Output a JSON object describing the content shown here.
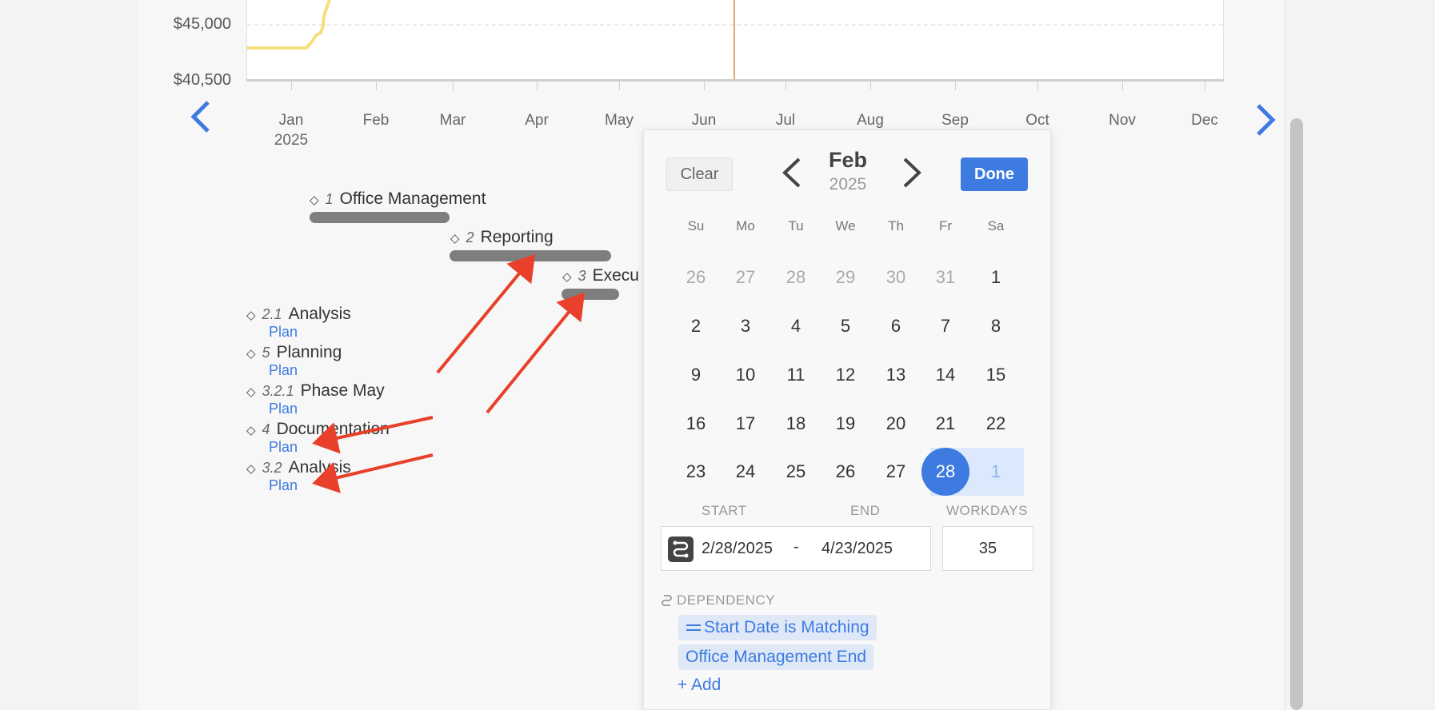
{
  "chart": {
    "y_labels": [
      "$45,000",
      "$40,500"
    ],
    "months": [
      "Jan",
      "Feb",
      "Mar",
      "Apr",
      "May",
      "Jun",
      "Jul",
      "Aug",
      "Sep",
      "Oct",
      "Nov",
      "Dec"
    ],
    "year_label": "2025",
    "series_color": "#f6de7a",
    "today_line_color": "#e3a86a"
  },
  "tasks": [
    {
      "num": "1",
      "name": "Office Management"
    },
    {
      "num": "2",
      "name": "Reporting"
    },
    {
      "num": "3",
      "name": "Execu"
    },
    {
      "num": "2.1",
      "name": "Analysis",
      "link": "Plan"
    },
    {
      "num": "5",
      "name": "Planning",
      "link": "Plan"
    },
    {
      "num": "3.2.1",
      "name": "Phase May",
      "link": "Plan"
    },
    {
      "num": "4",
      "name": "Documentation",
      "link": "Plan"
    },
    {
      "num": "3.2",
      "name": "Analysis",
      "link": "Plan"
    }
  ],
  "datepicker": {
    "clear_label": "Clear",
    "done_label": "Done",
    "month": "Feb",
    "year": "2025",
    "weekdays": [
      "Su",
      "Mo",
      "Tu",
      "We",
      "Th",
      "Fr",
      "Sa"
    ],
    "weeks": [
      [
        "26",
        "27",
        "28",
        "29",
        "30",
        "31",
        "1"
      ],
      [
        "2",
        "3",
        "4",
        "5",
        "6",
        "7",
        "8"
      ],
      [
        "9",
        "10",
        "11",
        "12",
        "13",
        "14",
        "15"
      ],
      [
        "16",
        "17",
        "18",
        "19",
        "20",
        "21",
        "22"
      ],
      [
        "23",
        "24",
        "25",
        "26",
        "27",
        "28",
        "1"
      ]
    ],
    "selected_day": "28",
    "start_label": "START",
    "end_label": "END",
    "workdays_label": "WORKDAYS",
    "start_value": "2/28/2025",
    "separator": "-",
    "end_value": "4/23/2025",
    "workdays_value": "35",
    "dependency_label": "DEPENDENCY",
    "dependency_type": "Start Date is Matching",
    "dependency_target": "Office Management End",
    "add_label": "+ Add",
    "accent_color": "#3d7be0"
  },
  "annotation_color": "#e8402a"
}
